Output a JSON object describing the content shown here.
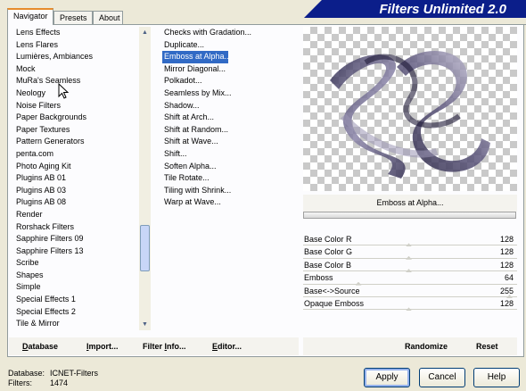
{
  "tabs": [
    "Navigator",
    "Presets",
    "About"
  ],
  "header": {
    "title": "Filters Unlimited 2.0"
  },
  "categories": [
    "Lens Effects",
    "Lens Flares",
    "Lumières, Ambiances",
    "Mock",
    "MuRa's Seamless",
    "Neology",
    "Noise Filters",
    "Paper Backgrounds",
    "Paper Textures",
    "Pattern Generators",
    "penta.com",
    "Photo Aging Kit",
    "Plugins AB 01",
    "Plugins AB 03",
    "Plugins AB 08",
    "Render",
    "Rorshack Filters",
    "Sapphire Filters 09",
    "Sapphire Filters 13",
    "Scribe",
    "Shapes",
    "Simple",
    "Special Effects 1",
    "Special Effects 2",
    "Tile & Mirror"
  ],
  "filters": [
    "Checks with Gradation...",
    "Duplicate...",
    "Emboss at Alpha...",
    "Mirror Diagonal...",
    "Polkadot...",
    "Seamless by Mix...",
    "Shadow...",
    "Shift at Arch...",
    "Shift at Random...",
    "Shift at Wave...",
    "Shift...",
    "Soften Alpha...",
    "Tile Rotate...",
    "Tiling with Shrink...",
    "Warp at Wave..."
  ],
  "selected_filter": "Emboss at Alpha...",
  "preview": {
    "filter_name": "Emboss at Alpha..."
  },
  "sliders": [
    {
      "name": "Base Color R",
      "value": "128",
      "fraction": 0.5
    },
    {
      "name": "Base Color G",
      "value": "128",
      "fraction": 0.5
    },
    {
      "name": "Base Color B",
      "value": "128",
      "fraction": 0.5
    },
    {
      "name": "Emboss",
      "value": "64",
      "fraction": 0.25
    },
    {
      "name": "Base<->Source",
      "value": "255",
      "fraction": 1.0
    },
    {
      "name": "Opaque Emboss",
      "value": "128",
      "fraction": 0.5
    }
  ],
  "bottom_links": {
    "database": {
      "u": "D",
      "rest": "atabase"
    },
    "import": {
      "u": "I",
      "rest": "mport..."
    },
    "filter_info": {
      "pre": "Filter ",
      "u": "I",
      "rest": "nfo..."
    },
    "editor": {
      "u": "E",
      "rest": "ditor..."
    },
    "randomize": "Randomize",
    "reset": "Reset"
  },
  "footer": {
    "database_label": "Database:",
    "database_value": "ICNET-Filters",
    "filters_label": "Filters:",
    "filters_value": "1474"
  },
  "buttons": {
    "apply": "Apply",
    "cancel": "Cancel",
    "help": "Help"
  }
}
